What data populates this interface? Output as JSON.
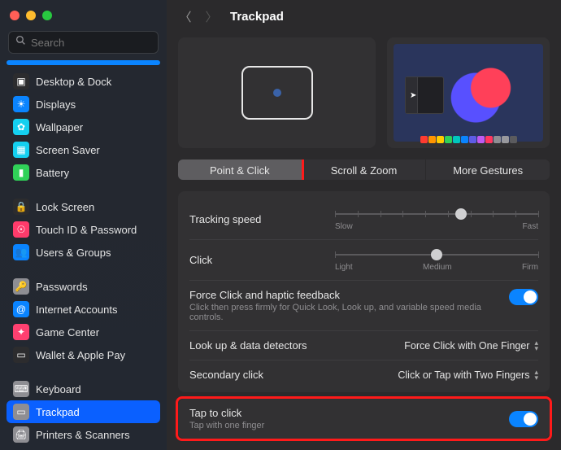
{
  "window": {
    "title": "Trackpad"
  },
  "search": {
    "placeholder": "Search"
  },
  "sidebar": {
    "groups": [
      [
        {
          "label": "Desktop & Dock",
          "icon_bg": "#2c2c2e",
          "icon": "▣"
        },
        {
          "label": "Displays",
          "icon_bg": "#0a84ff",
          "icon": "☀"
        },
        {
          "label": "Wallpaper",
          "icon_bg": "#14d0f0",
          "icon": "✿"
        },
        {
          "label": "Screen Saver",
          "icon_bg": "#14d0f0",
          "icon": "▦"
        },
        {
          "label": "Battery",
          "icon_bg": "#30d158",
          "icon": "▮"
        }
      ],
      [
        {
          "label": "Lock Screen",
          "icon_bg": "#2c2c2e",
          "icon": "🔒"
        },
        {
          "label": "Touch ID & Password",
          "icon_bg": "#ff3b6b",
          "icon": "☉"
        },
        {
          "label": "Users & Groups",
          "icon_bg": "#0a84ff",
          "icon": "👥"
        }
      ],
      [
        {
          "label": "Passwords",
          "icon_bg": "#8e8e93",
          "icon": "🔑"
        },
        {
          "label": "Internet Accounts",
          "icon_bg": "#0a84ff",
          "icon": "@"
        },
        {
          "label": "Game Center",
          "icon_bg": "#ff4070",
          "icon": "✦"
        },
        {
          "label": "Wallet & Apple Pay",
          "icon_bg": "#2c2c2e",
          "icon": "▭"
        }
      ],
      [
        {
          "label": "Keyboard",
          "icon_bg": "#8e8e93",
          "icon": "⌨"
        },
        {
          "label": "Trackpad",
          "icon_bg": "#8e8e93",
          "icon": "▭",
          "selected": true
        },
        {
          "label": "Printers & Scanners",
          "icon_bg": "#8e8e93",
          "icon": "🖨"
        }
      ]
    ]
  },
  "tabs": [
    {
      "label": "Point & Click",
      "active": true,
      "highlight": true
    },
    {
      "label": "Scroll & Zoom",
      "active": false
    },
    {
      "label": "More Gestures",
      "active": false
    }
  ],
  "tracking": {
    "label": "Tracking speed",
    "min_label": "Slow",
    "max_label": "Fast",
    "ticks": 10,
    "knob_pct": 62
  },
  "click": {
    "label": "Click",
    "left_label": "Light",
    "mid_label": "Medium",
    "right_label": "Firm",
    "ticks": 3,
    "knob_pct": 50
  },
  "force_click": {
    "label": "Force Click and haptic feedback",
    "sub": "Click then press firmly for Quick Look, Look up, and variable speed media controls.",
    "on": true
  },
  "lookup": {
    "label": "Look up & data detectors",
    "value": "Force Click with One Finger"
  },
  "secondary": {
    "label": "Secondary click",
    "value": "Click or Tap with Two Fingers"
  },
  "tap": {
    "label": "Tap to click",
    "sub": "Tap with one finger",
    "on": true
  },
  "swatch_colors": [
    "#ff3b30",
    "#ff9500",
    "#ffcc00",
    "#30d158",
    "#00c7be",
    "#0a84ff",
    "#5e5ce6",
    "#bf5af2",
    "#ff375f",
    "#8e8e93",
    "#98989d",
    "#5b5b5e"
  ]
}
